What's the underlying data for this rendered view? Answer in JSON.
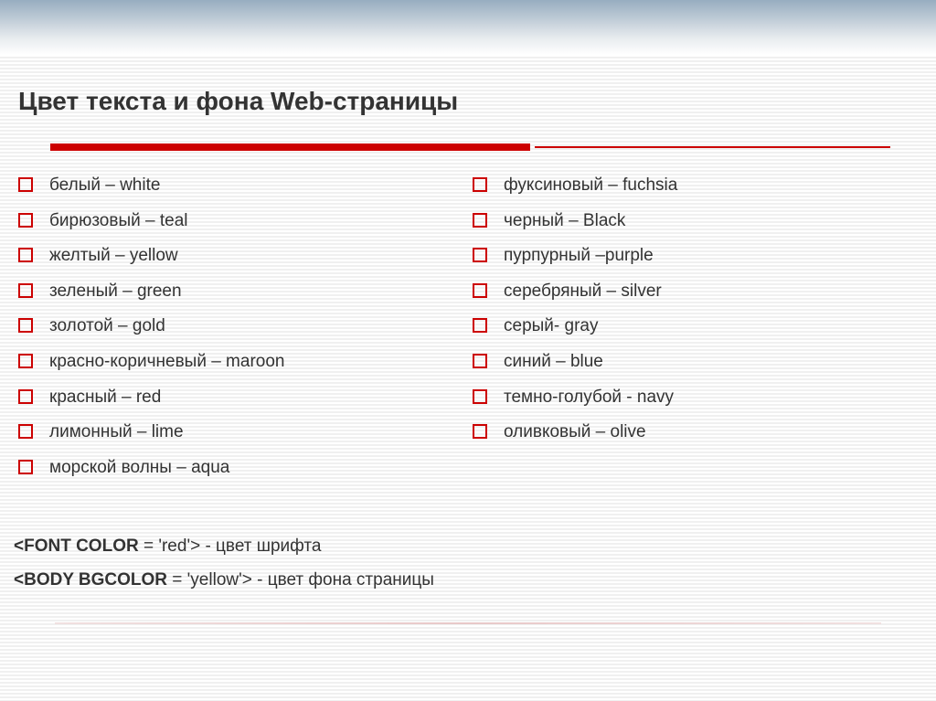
{
  "title": "Цвет текста и фона Web-страницы",
  "left_column": [
    "белый – white",
    "бирюзовый – teal",
    "желтый – yellow",
    "зеленый – green",
    "золотой – gold",
    "красно-коричневый – maroon",
    "красный – red",
    "лимонный – lime",
    "морской волны – aqua"
  ],
  "right_column": [
    "фуксиновый – fuchsia",
    "черный – Black",
    "пурпурный –purple",
    "серебряный – silver",
    "серый- gray",
    "синий –  blue",
    "темно-голубой - navy",
    "оливковый – olive"
  ],
  "code_examples": [
    {
      "bold": "<FONT COLOR",
      "rest": " = 'red'>  - цвет шрифта"
    },
    {
      "bold": "<BODY BGCOLOR",
      "rest": " = 'yellow'>   - цвет фона страницы"
    }
  ]
}
